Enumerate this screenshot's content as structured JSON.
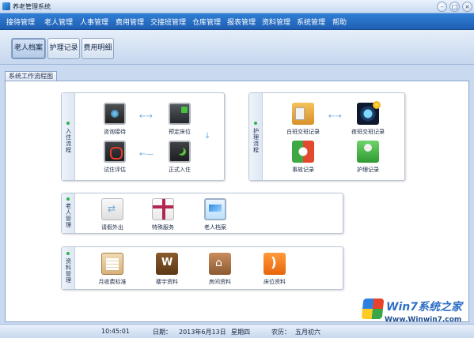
{
  "window": {
    "title": "养老管理系统",
    "controls": [
      "minimize-icon",
      "maximize-icon",
      "close-icon"
    ]
  },
  "menubar": {
    "items": [
      "接待管理",
      "老人管理",
      "人事管理",
      "费用管理",
      "交接班管理",
      "仓库管理",
      "报表管理",
      "资料管理",
      "系统管理",
      "帮助"
    ]
  },
  "toolbar": {
    "buttons": [
      "老人档案",
      "护理记录",
      "费用明细"
    ],
    "active": "老人档案"
  },
  "tab": {
    "label": "系统工作流程图"
  },
  "groups": {
    "admission": {
      "label": "入住流程",
      "items": [
        {
          "label": "咨询接待",
          "icon": "monitor-icon"
        },
        {
          "label": "预定床位",
          "icon": "lock-icon"
        },
        {
          "label": "试住评估",
          "icon": "power-icon"
        },
        {
          "label": "正式入住",
          "icon": "moon-icon"
        }
      ]
    },
    "nursing": {
      "label": "护理流程",
      "items": [
        {
          "label": "白班交班记录",
          "icon": "folder-icon"
        },
        {
          "label": "夜班交班记录",
          "icon": "camera-icon"
        },
        {
          "label": "事故记录",
          "icon": "refresh-icon"
        },
        {
          "label": "护理记录",
          "icon": "person-icon"
        }
      ]
    },
    "elder": {
      "label": "老人管理",
      "items": [
        {
          "label": "请假外出",
          "icon": "usb-icon"
        },
        {
          "label": "特殊服务",
          "icon": "gift-icon"
        },
        {
          "label": "老人档案",
          "icon": "screen-icon"
        }
      ]
    },
    "resource": {
      "label": "资料管理",
      "items": [
        {
          "label": "月收费标准",
          "icon": "calendar-icon"
        },
        {
          "label": "楼宇资料",
          "icon": "w-icon"
        },
        {
          "label": "房间资料",
          "icon": "house-icon"
        },
        {
          "label": "床位资料",
          "icon": "rss-icon"
        }
      ]
    }
  },
  "statusbar": {
    "time": "10:45:01",
    "date_label": "日期：",
    "date": "2013年6月13日",
    "weekday": "星期四",
    "lunar_label": "农历：",
    "lunar": "五月初六"
  },
  "watermark": {
    "title": "Win7系统之家",
    "url": "Www.Winwin7.com"
  }
}
